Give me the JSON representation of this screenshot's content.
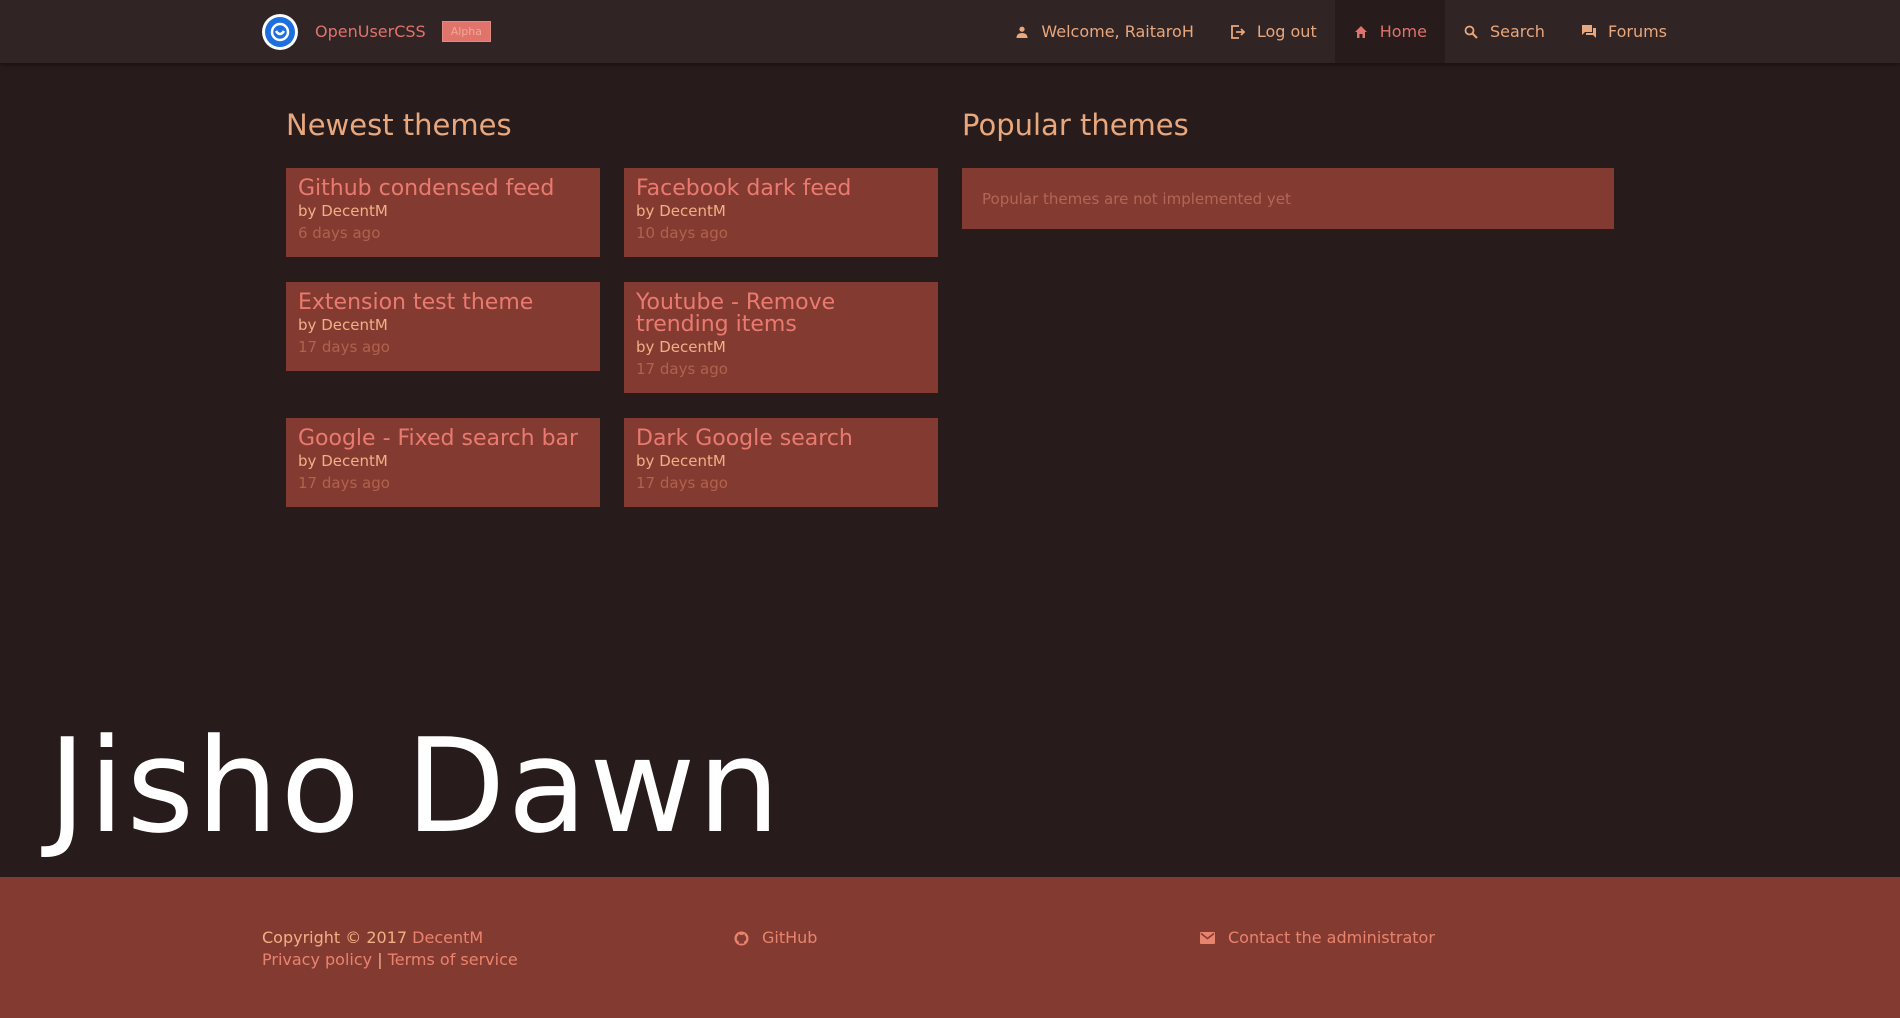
{
  "navbar": {
    "brand_name": "OpenUserCSS",
    "badge": "Alpha",
    "items": [
      {
        "label": "Welcome, RaitaroH",
        "icon": "person-icon"
      },
      {
        "label": "Log out",
        "icon": "logout-icon"
      },
      {
        "label": "Home",
        "icon": "home-icon",
        "active": true
      },
      {
        "label": "Search",
        "icon": "search-icon"
      },
      {
        "label": "Forums",
        "icon": "forum-icon"
      }
    ]
  },
  "newest": {
    "title": "Newest themes",
    "themes": [
      {
        "title": "Github condensed feed",
        "by": "by",
        "author": "DecentM",
        "date": "6 days ago"
      },
      {
        "title": "Facebook dark feed",
        "by": "by",
        "author": "DecentM",
        "date": "10 days ago"
      },
      {
        "title": "Extension test theme",
        "by": "by",
        "author": "DecentM",
        "date": "17 days ago"
      },
      {
        "title": "Youtube - Remove trending items",
        "by": "by",
        "author": "DecentM",
        "date": "17 days ago"
      },
      {
        "title": "Google - Fixed search bar",
        "by": "by",
        "author": "DecentM",
        "date": "17 days ago"
      },
      {
        "title": "Dark Google search",
        "by": "by",
        "author": "DecentM",
        "date": "17 days ago"
      }
    ]
  },
  "popular": {
    "title": "Popular themes",
    "message": "Popular themes are not implemented yet"
  },
  "overlay_text": "Jisho Dawn",
  "footer": {
    "copyright": "Copyright © 2017",
    "copyright_owner": "DecentM",
    "privacy": "Privacy policy",
    "separator": "|",
    "terms": "Terms of service",
    "github": "GitHub",
    "contact": "Contact the administrator"
  },
  "colors": {
    "background": "#271b1b",
    "navbar": "#312424",
    "card": "#833b31",
    "accent": "#e0736b",
    "heading": "#e8a77d"
  }
}
